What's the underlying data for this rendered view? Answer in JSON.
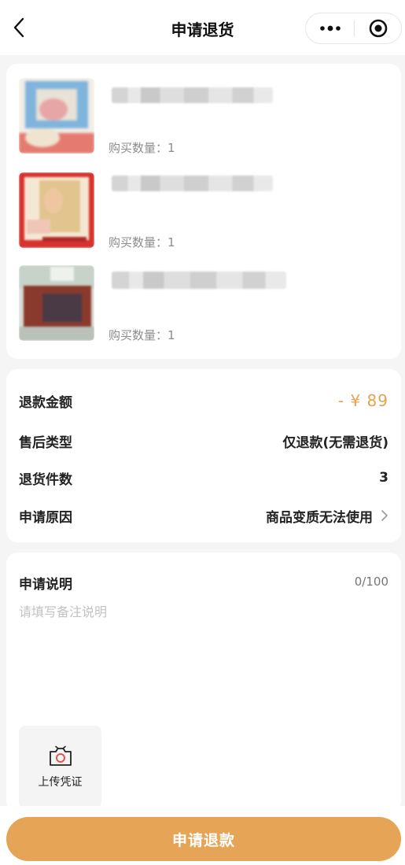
{
  "nav": {
    "title": "申请退货",
    "back_icon": "chevron-left-icon",
    "more_icon": "more-dots-icon",
    "target_icon": "target-icon"
  },
  "products": [
    {
      "quantity_label": "购买数量：1",
      "image_icon": "product-image"
    },
    {
      "quantity_label": "购买数量：1",
      "image_icon": "product-image"
    },
    {
      "quantity_label": "购买数量：1",
      "image_icon": "product-image"
    }
  ],
  "refund": {
    "amount_label": "退款金额",
    "amount_value": "- ¥ 89",
    "type_label": "售后类型",
    "type_value": "仅退款(无需退货)",
    "count_label": "退货件数",
    "count_value": "3",
    "reason_label": "申请原因",
    "reason_value": "商品变质无法使用",
    "reason_icon": "chevron-right-icon"
  },
  "description": {
    "title": "申请说明",
    "counter": "0/100",
    "placeholder": "请填写备注说明",
    "upload_label": "上传凭证",
    "upload_icon": "camera-icon"
  },
  "footer": {
    "submit_label": "申请退款"
  },
  "colors": {
    "accent": "#e6a456",
    "amount": "#e6a24e",
    "background": "#f5f5f5"
  }
}
